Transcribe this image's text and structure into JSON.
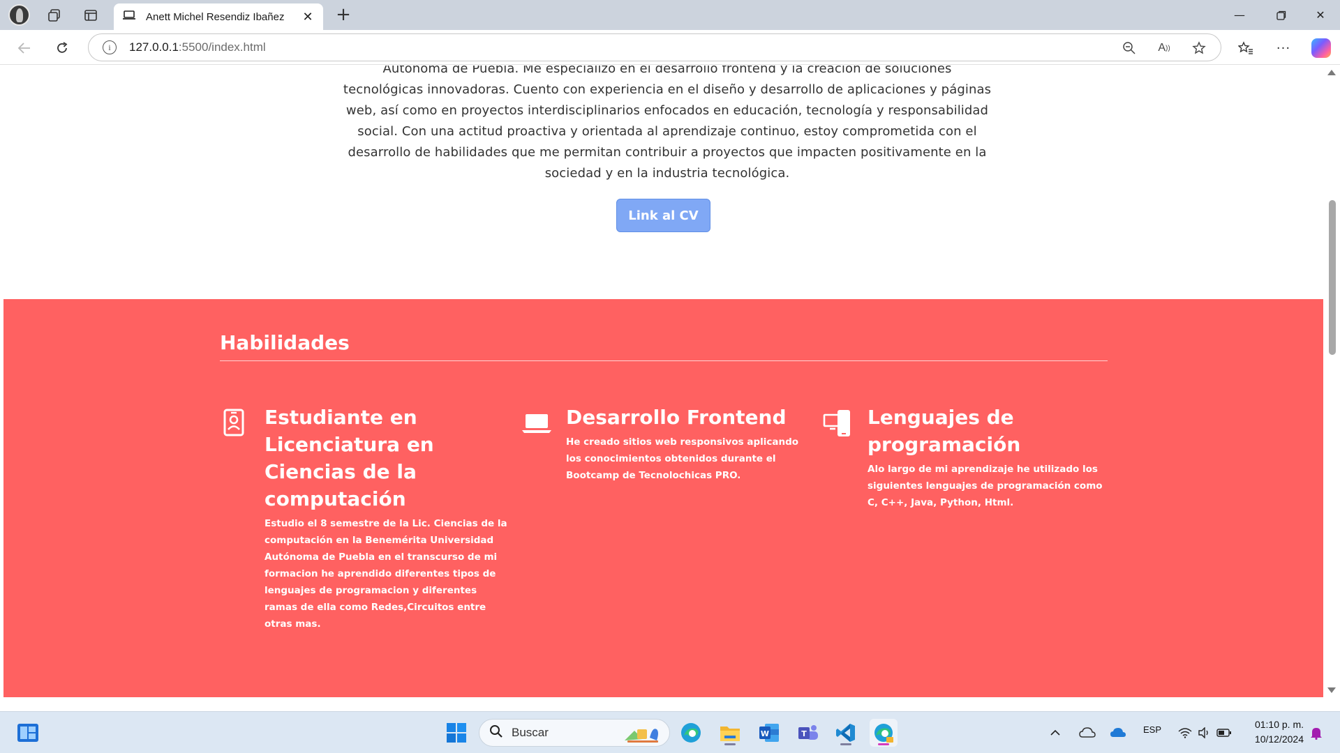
{
  "browser": {
    "tab_title": "Anett Michel Resendiz Ibañez",
    "url_host": "127.0.0.1",
    "url_rest": ":5500/index.html"
  },
  "page": {
    "about_text": "Autónoma de Puebla. Me especializo en el desarrollo frontend y la creación de soluciones tecnológicas innovadoras. Cuento con experiencia en el diseño y desarrollo de aplicaciones y páginas web, así como en proyectos interdisciplinarios enfocados en educación, tecnología y responsabilidad social. Con una actitud proactiva y orientada al aprendizaje continuo, estoy comprometida con el desarrollo de habilidades que me permitan contribuir a proyectos que impacten positivamente en la sociedad y en la industria tecnológica.",
    "cv_button": "Link al CV",
    "skills_title": "Habilidades",
    "skills": [
      {
        "title": "Estudiante en Licenciatura en Ciencias de la computación",
        "description": "Estudio el 8 semestre de la Lic. Ciencias de la computación en la Benemérita Universidad Autónoma de Puebla en el transcurso de mi formacion he aprendido diferentes tipos de lenguajes de programacion y diferentes ramas de ella como Redes,Circuitos entre otras mas.",
        "icon": "id-badge-icon"
      },
      {
        "title": "Desarrollo Frontend",
        "description": "He creado sitios web responsivos aplicando los conocimientos obtenidos durante el Bootcamp de Tecnolochicas PRO.",
        "icon": "laptop-icon"
      },
      {
        "title": "Lenguajes de programación",
        "description": "Alo largo de mi aprendizaje he utilizado los siguientes lenguajes de programación como C, C++, Java, Python, Html.",
        "icon": "devices-icon"
      }
    ]
  },
  "taskbar": {
    "search_placeholder": "Buscar",
    "language": "ESP",
    "time": "01:10 p. m.",
    "date": "10/12/2024"
  },
  "colors": {
    "skills_background": "#ff6161",
    "cv_button": "#80a8f5"
  }
}
